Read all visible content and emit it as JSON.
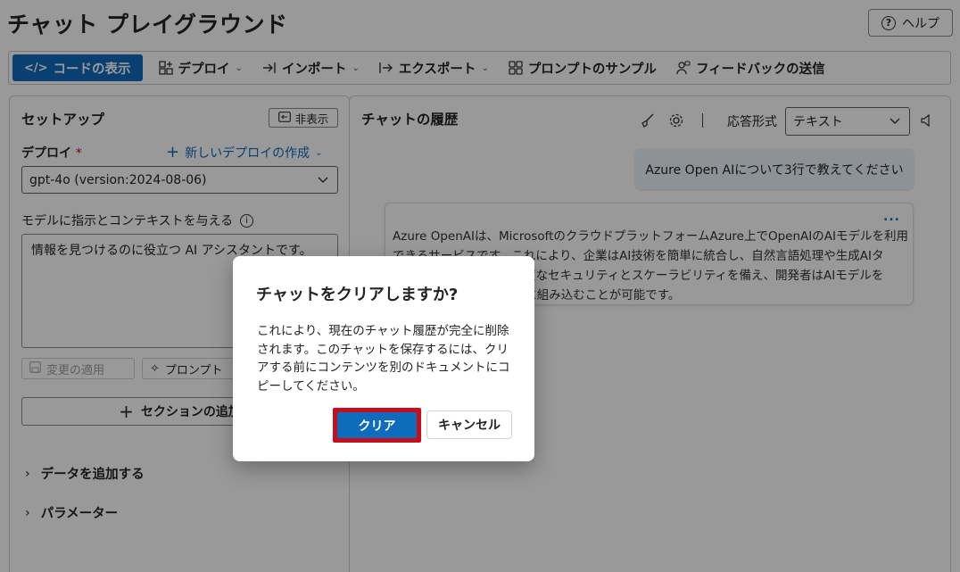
{
  "page": {
    "title": "チャット プレイグラウンド",
    "help_label": "ヘルプ"
  },
  "toolbar": {
    "view_code": "コードの表示",
    "deploy": "デプロイ",
    "import": "インポート",
    "export": "エクスポート",
    "prompt_samples": "プロンプトのサンプル",
    "feedback": "フィードバックの送信"
  },
  "setup": {
    "title": "セットアップ",
    "hide_label": "非表示",
    "deploy_label": "デプロイ",
    "required_mark": "*",
    "new_deploy_link": "新しいデプロイの作成",
    "deploy_value": "gpt-4o (version:2024-08-06)",
    "instructions_label": "モデルに指示とコンテキストを与える",
    "system_message": "情報を見つけるのに役立つ AI アシスタントです。",
    "apply_changes": "変更の適用",
    "prompt_button": "プロンプト",
    "add_section": "セクションの追加",
    "add_data": "データを追加する",
    "parameters": "パラメーター"
  },
  "chat": {
    "title": "チャットの履歴",
    "response_format_label": "応答形式",
    "response_format_value": "テキスト",
    "user_message": "Azure Open AIについて3行で教えてください",
    "ai_more": "...",
    "ai_line1": "Azure OpenAIは、MicrosoftのクラウドプラットフォームAzure上でOpenAIのAIモデルを利用",
    "ai_line2": "できるサービスです。これにより、企業はAI技術を簡単に統合し、自然言語処理や生成AIタ",
    "ai_line3": "スクを実行できます。高度なセキュリティとスケーラビリティを備え、開発者はAIモデルを",
    "ai_line4": "簡単にアプリケーションに組み込むことが可能です。"
  },
  "dialog": {
    "title": "チャットをクリアしますか?",
    "body": "これにより、現在のチャット履歴が完全に削除されます。このチャットを保存するには、クリアする前にコンテンツを別のドキュメントにコピーしてください。",
    "confirm": "クリア",
    "cancel": "キャンセル"
  },
  "colors": {
    "accent": "#0f6cbd",
    "highlight": "#c50f1f"
  }
}
